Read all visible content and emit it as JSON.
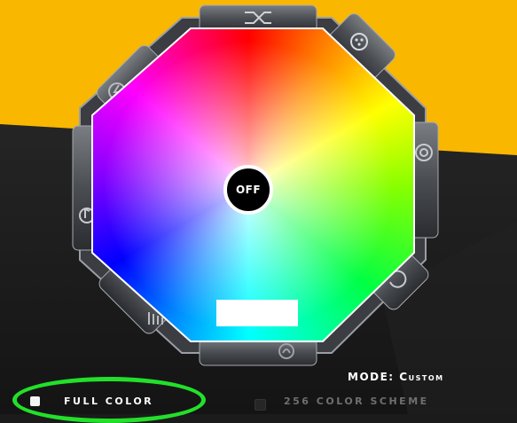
{
  "colors": {
    "accent_yellow": "#f9b700",
    "highlight_green": "#22e02a",
    "panel_dark": "#1b1b1b",
    "selected_swatch": "#ffffff"
  },
  "wheel": {
    "center_button_label": "OFF"
  },
  "mode": {
    "label": "MODE:",
    "value": "Custom"
  },
  "color_options": [
    {
      "label": "FULL COLOR",
      "checked": true
    },
    {
      "label": "256 COLOR SCHEME",
      "checked": false
    }
  ],
  "icons": [
    "shuffle-icon",
    "settings-dots-icon",
    "target-icon",
    "refresh-icon",
    "wave-icon",
    "equalizer-icon",
    "music-note-icon",
    "lightning-icon"
  ]
}
